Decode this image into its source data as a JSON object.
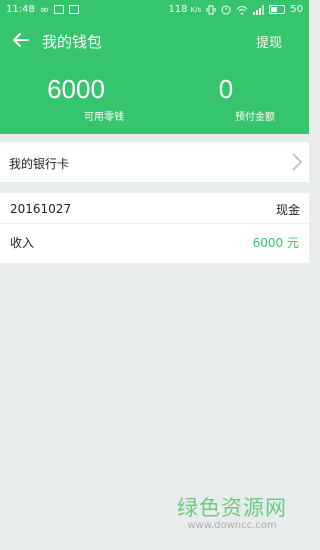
{
  "status_bar": {
    "time": "11:48",
    "network_speed": "118",
    "network_unit": "K/s",
    "battery": "50"
  },
  "header": {
    "title": "我的钱包",
    "withdraw_label": "提现",
    "available_amount": "6000",
    "available_label": "可用零钱",
    "prepaid_amount": "0",
    "prepaid_label": "预付金额"
  },
  "bank_card": {
    "label": "我的银行卡"
  },
  "transaction": {
    "date": "20161027",
    "type": "现金",
    "kind": "收入",
    "amount": "6000 元"
  },
  "watermark": {
    "text": "绿色资源网",
    "url": "www.downcc.com"
  },
  "colors": {
    "accent": "#36c46c",
    "background": "#e9eced"
  }
}
